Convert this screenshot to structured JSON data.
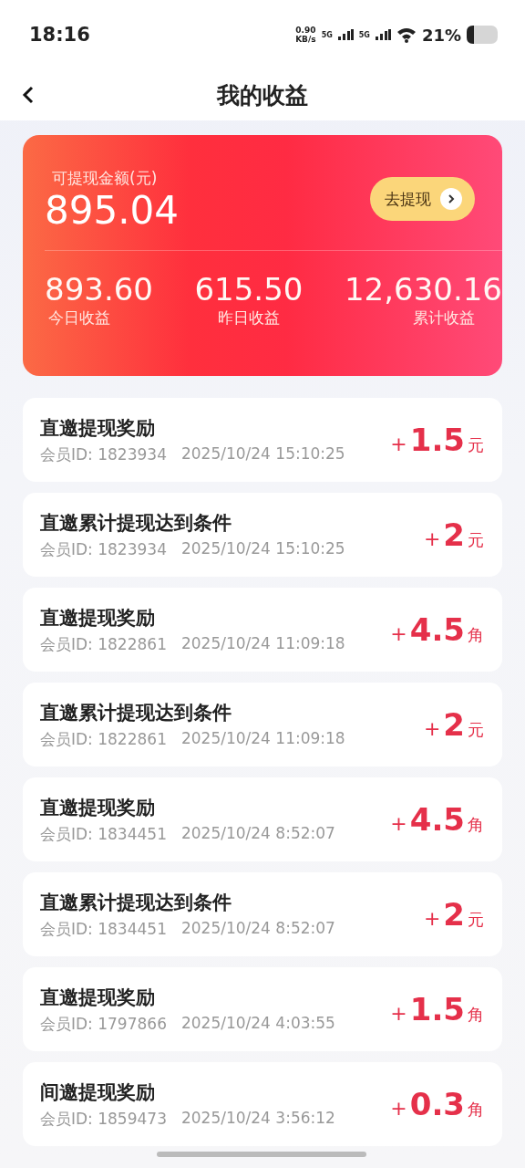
{
  "status_bar": {
    "time": "18:16",
    "net_speed": "0.90",
    "net_unit": "KB/s",
    "sim1": "5G",
    "sim2": "5G",
    "battery": "21%"
  },
  "header": {
    "title": "我的收益"
  },
  "summary": {
    "balance_label": "可提现金额(元)",
    "balance": "895.04",
    "withdraw_button": "去提现",
    "stats": [
      {
        "value": "893.60",
        "label": "今日收益"
      },
      {
        "value": "615.50",
        "label": "昨日收益"
      },
      {
        "value": "12,630.16",
        "label": "累计收益"
      }
    ]
  },
  "records": [
    {
      "title": "直邀提现奖励",
      "member": "会员ID: 1823934",
      "time": "2025/10/24 15:10:25",
      "sign": "+",
      "amount": "1.5",
      "unit": "元"
    },
    {
      "title": "直邀累计提现达到条件",
      "member": "会员ID: 1823934",
      "time": "2025/10/24 15:10:25",
      "sign": "+",
      "amount": "2",
      "unit": "元"
    },
    {
      "title": "直邀提现奖励",
      "member": "会员ID: 1822861",
      "time": "2025/10/24 11:09:18",
      "sign": "+",
      "amount": "4.5",
      "unit": "角"
    },
    {
      "title": "直邀累计提现达到条件",
      "member": "会员ID: 1822861",
      "time": "2025/10/24 11:09:18",
      "sign": "+",
      "amount": "2",
      "unit": "元"
    },
    {
      "title": "直邀提现奖励",
      "member": "会员ID: 1834451",
      "time": "2025/10/24 8:52:07",
      "sign": "+",
      "amount": "4.5",
      "unit": "角"
    },
    {
      "title": "直邀累计提现达到条件",
      "member": "会员ID: 1834451",
      "time": "2025/10/24 8:52:07",
      "sign": "+",
      "amount": "2",
      "unit": "元"
    },
    {
      "title": "直邀提现奖励",
      "member": "会员ID: 1797866",
      "time": "2025/10/24 4:03:55",
      "sign": "+",
      "amount": "1.5",
      "unit": "角"
    },
    {
      "title": "间邀提现奖励",
      "member": "会员ID: 1859473",
      "time": "2025/10/24 3:56:12",
      "sign": "+",
      "amount": "0.3",
      "unit": "角"
    }
  ]
}
